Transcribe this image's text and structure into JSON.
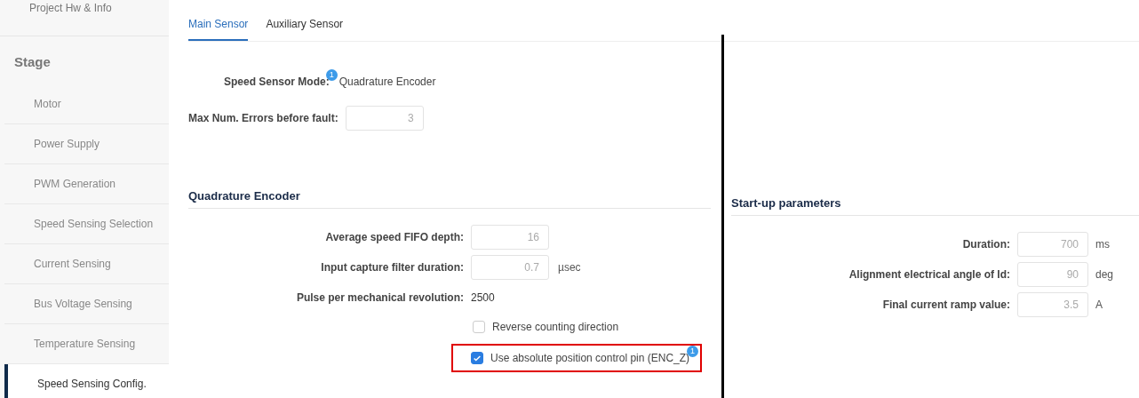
{
  "sidebar": {
    "header": "Project Hw & Info",
    "section": "Stage",
    "items": [
      {
        "label": "Motor",
        "selected": false
      },
      {
        "label": "Power Supply",
        "selected": false
      },
      {
        "label": "PWM Generation",
        "selected": false
      },
      {
        "label": "Speed Sensing Selection",
        "selected": false
      },
      {
        "label": "Current Sensing",
        "selected": false
      },
      {
        "label": "Bus Voltage Sensing",
        "selected": false
      },
      {
        "label": "Temperature Sensing",
        "selected": false
      },
      {
        "label": "Speed Sensing Config.",
        "selected": true
      }
    ]
  },
  "tabs": [
    {
      "label": "Main Sensor",
      "selected": true
    },
    {
      "label": "Auxiliary Sensor",
      "selected": false
    }
  ],
  "sensor": {
    "mode_label": "Speed Sensor Mode:",
    "mode_badge": "1",
    "mode_value": "Quadrature Encoder",
    "max_errors_label": "Max Num. Errors before fault:",
    "max_errors_value": "3"
  },
  "quadrature_encoder": {
    "title": "Quadrature Encoder",
    "fields": [
      {
        "kind": "input",
        "label": "Average speed FIFO depth:",
        "value": "16"
      },
      {
        "kind": "input",
        "label": "Input capture filter duration:",
        "value": "0.7",
        "unit": "µsec"
      },
      {
        "kind": "text",
        "label": "Pulse per mechanical revolution:",
        "value": "2500"
      }
    ],
    "checkboxes": [
      {
        "label": "Reverse counting direction",
        "checked": false,
        "highlighted": false
      },
      {
        "label": "Use absolute position control pin (ENC_Z)",
        "checked": true,
        "badge": "1",
        "highlighted": true
      }
    ]
  },
  "startup_parameters": {
    "title": "Start-up parameters",
    "fields": [
      {
        "kind": "input",
        "label": "Duration:",
        "value": "700",
        "unit": "ms"
      },
      {
        "kind": "input",
        "label": "Alignment electrical angle of Id:",
        "value": "90",
        "unit": "deg"
      },
      {
        "kind": "input",
        "label": "Final current ramp value:",
        "value": "3.5",
        "unit": "A"
      }
    ]
  }
}
